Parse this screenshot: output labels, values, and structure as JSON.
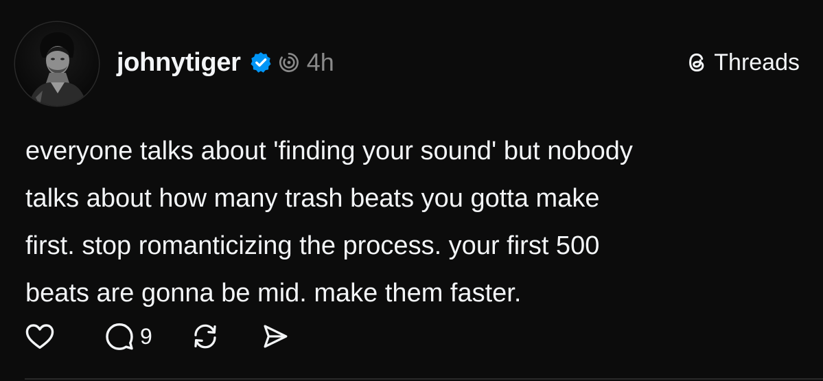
{
  "post": {
    "author": {
      "username": "johnytiger",
      "verified_icon": "verified-badge-icon",
      "ai_icon": "ai-label-icon",
      "avatar_icon": "avatar"
    },
    "timestamp": "4h",
    "brand": {
      "label": "Threads",
      "icon": "threads-logo-icon"
    },
    "body_text": "everyone talks about 'finding your sound' but nobody\ntalks about how many trash beats you gotta make\nfirst. stop romanticizing the process. your first 500\nbeats are gonna be mid. make them faster.",
    "actions": {
      "like_icon": "heart-icon",
      "reply_icon": "comment-icon",
      "reply_count": "9",
      "repost_icon": "repost-icon",
      "share_icon": "share-icon"
    }
  },
  "colors": {
    "background": "#0c0c0c",
    "text_primary": "#f3f5f7",
    "text_secondary": "#8a8a8a",
    "verified_blue": "#0095f6"
  }
}
